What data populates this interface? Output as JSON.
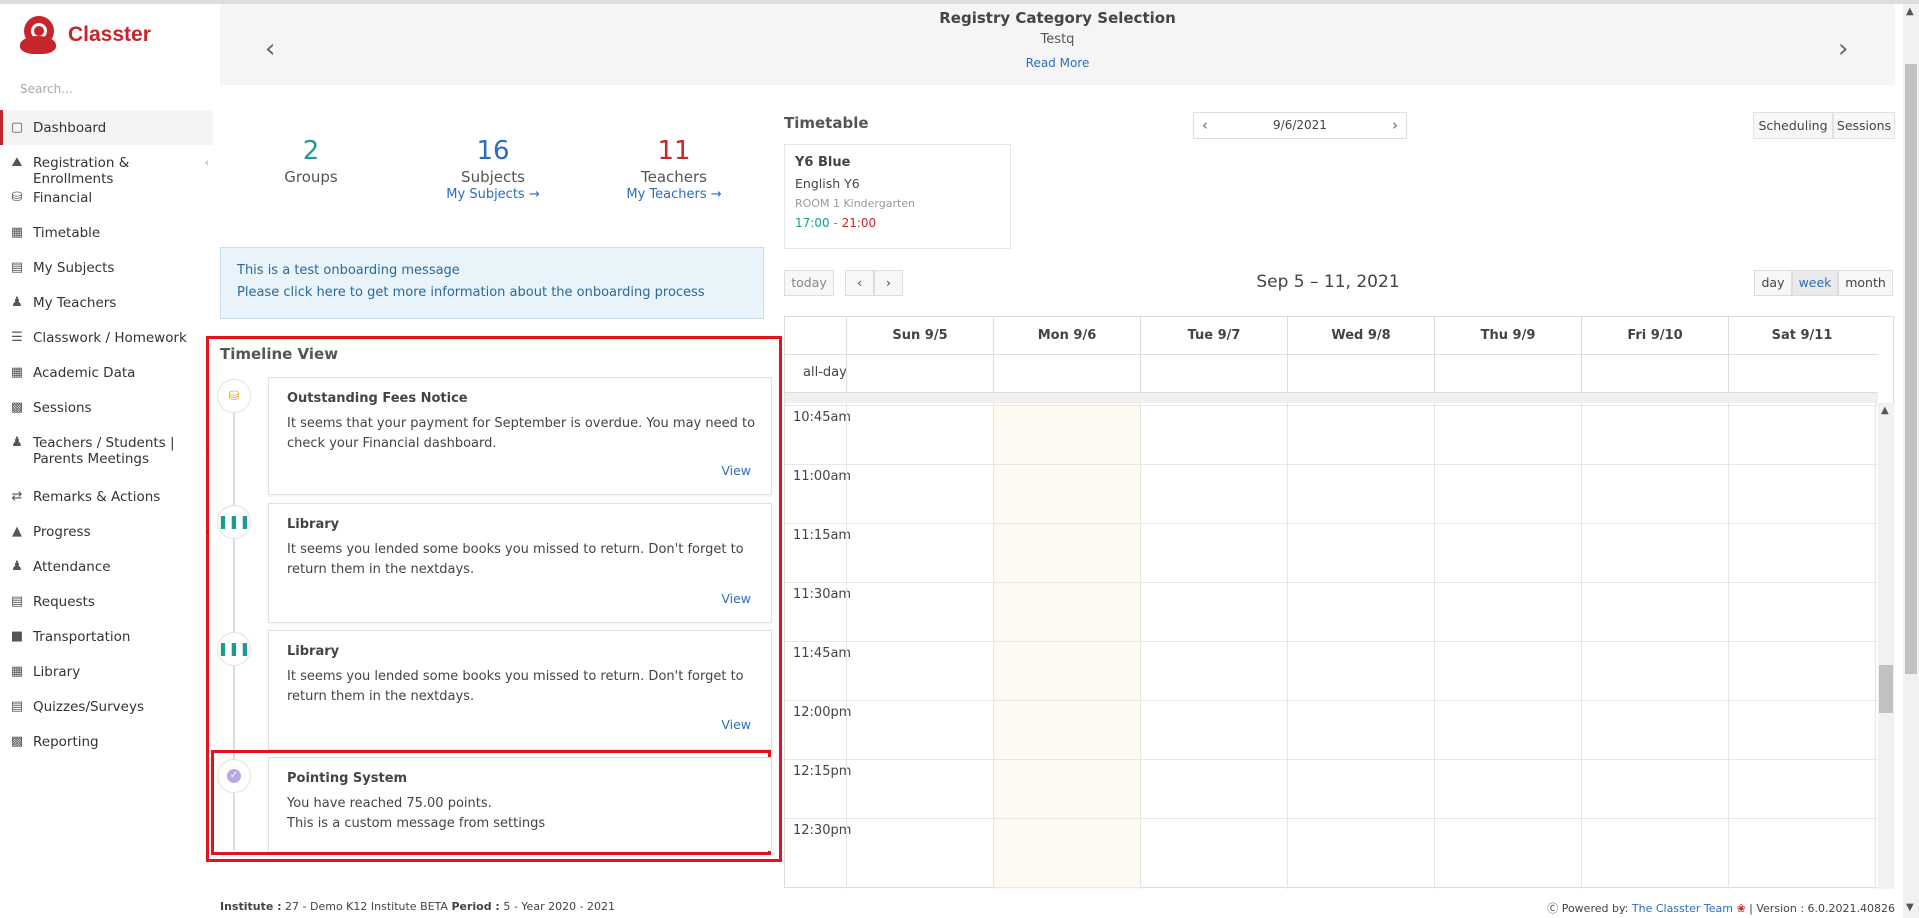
{
  "app": {
    "name": "Classter",
    "search_placeholder": "Search..."
  },
  "sidebar": {
    "items": [
      {
        "label": "Dashboard",
        "icon": "laptop-icon",
        "active": true,
        "chevron": ""
      },
      {
        "label": "Registration & Enrollments",
        "icon": "institution-icon",
        "chevron": "‹"
      },
      {
        "label": "Financial",
        "icon": "coins-icon",
        "chevron": ""
      },
      {
        "label": "Timetable",
        "icon": "calendar-icon",
        "chevron": ""
      },
      {
        "label": "My Subjects",
        "icon": "book-icon",
        "chevron": ""
      },
      {
        "label": "My Teachers",
        "icon": "users-icon",
        "chevron": ""
      },
      {
        "label": "Classwork / Homework",
        "icon": "list-icon",
        "chevron": ""
      },
      {
        "label": "Academic Data",
        "icon": "chart-icon",
        "chevron": ""
      },
      {
        "label": "Sessions",
        "icon": "presentation-icon",
        "chevron": "‹"
      },
      {
        "label": "Teachers / Students | Parents Meetings",
        "icon": "meeting-icon",
        "chevron": "‹"
      },
      {
        "label": "Remarks & Actions",
        "icon": "shuffle-icon",
        "chevron": ""
      },
      {
        "label": "Progress",
        "icon": "graduation-cap-icon",
        "chevron": "‹"
      },
      {
        "label": "Attendance",
        "icon": "user-check-icon",
        "chevron": ""
      },
      {
        "label": "Requests",
        "icon": "document-icon",
        "chevron": ""
      },
      {
        "label": "Transportation",
        "icon": "bus-icon",
        "chevron": ""
      },
      {
        "label": "Library",
        "icon": "books-icon",
        "chevron": "‹"
      },
      {
        "label": "Quizzes/Surveys",
        "icon": "checklist-icon",
        "chevron": ""
      },
      {
        "label": "Reporting",
        "icon": "printer-icon",
        "chevron": ""
      }
    ]
  },
  "banner": {
    "title": "Registry Category Selection",
    "subtitle": "Testq",
    "link": "Read More",
    "prev": "‹",
    "next": "›"
  },
  "stats": [
    {
      "value": "2",
      "label": "Groups",
      "link": "",
      "color": "#1a9d8f"
    },
    {
      "value": "16",
      "label": "Subjects",
      "link": "My Subjects  →",
      "color": "#2a6ebb"
    },
    {
      "value": "11",
      "label": "Teachers",
      "link": "My Teachers  →",
      "color": "#c5252b"
    }
  ],
  "onboarding": {
    "line1": "This is a test onboarding message",
    "line2": "Please click here to get more information about the onboarding process"
  },
  "timeline": {
    "title": "Timeline View",
    "items": [
      {
        "icon": "coins-icon",
        "icon_color": "#e8a02b",
        "title": "Outstanding Fees Notice",
        "body": "It seems that your payment for September is overdue. You may need to check your Financial dashboard.",
        "action": "View"
      },
      {
        "icon": "books-icon",
        "icon_color": "#1a9d8f",
        "title": "Library",
        "body": "It seems you lended some books you missed to return. Don't forget to return them in the nextdays.",
        "action": "View"
      },
      {
        "icon": "books-icon",
        "icon_color": "#1a9d8f",
        "title": "Library",
        "body": "It seems you lended some books you missed to return. Don't forget to return them in the nextdays.",
        "action": "View"
      },
      {
        "icon": "check-badge-icon",
        "icon_color": "#8e7cc3",
        "title": "Pointing System",
        "body_line1": "You have reached 75.00 points.",
        "body_line2": "This is a custom message from settings"
      }
    ]
  },
  "timetable": {
    "title": "Timetable",
    "date": "9/6/2021",
    "buttons": {
      "scheduling": "Scheduling",
      "sessions": "Sessions"
    },
    "lesson": {
      "group": "Y6 Blue",
      "subject": "English Y6",
      "room": "ROOM 1 Kindergarten",
      "start": "17:00",
      "sep": " - ",
      "end": "21:00"
    }
  },
  "calendar": {
    "today": "today",
    "prev": "‹",
    "next": "›",
    "range": "Sep 5 – 11, 2021",
    "views": {
      "day": "day",
      "week": "week",
      "month": "month"
    },
    "active_view": "week",
    "days": [
      "Sun 9/5",
      "Mon 9/6",
      "Tue 9/7",
      "Wed 9/8",
      "Thu 9/9",
      "Fri 9/10",
      "Sat 9/11"
    ],
    "allday": "all-day",
    "times": [
      "10:45am",
      "11:00am",
      "11:15am",
      "11:30am",
      "11:45am",
      "12:00pm",
      "12:15pm",
      "12:30pm"
    ]
  },
  "footer": {
    "institute_label": "Institute :",
    "institute": " 27 - Demo K12 Institute BETA ",
    "period_label": "Period :",
    "period": " 5 - Year 2020 - 2021",
    "powered": "Powered by: ",
    "team": "The Classter Team",
    "version": " | Version : 6.0.2021.40826"
  }
}
